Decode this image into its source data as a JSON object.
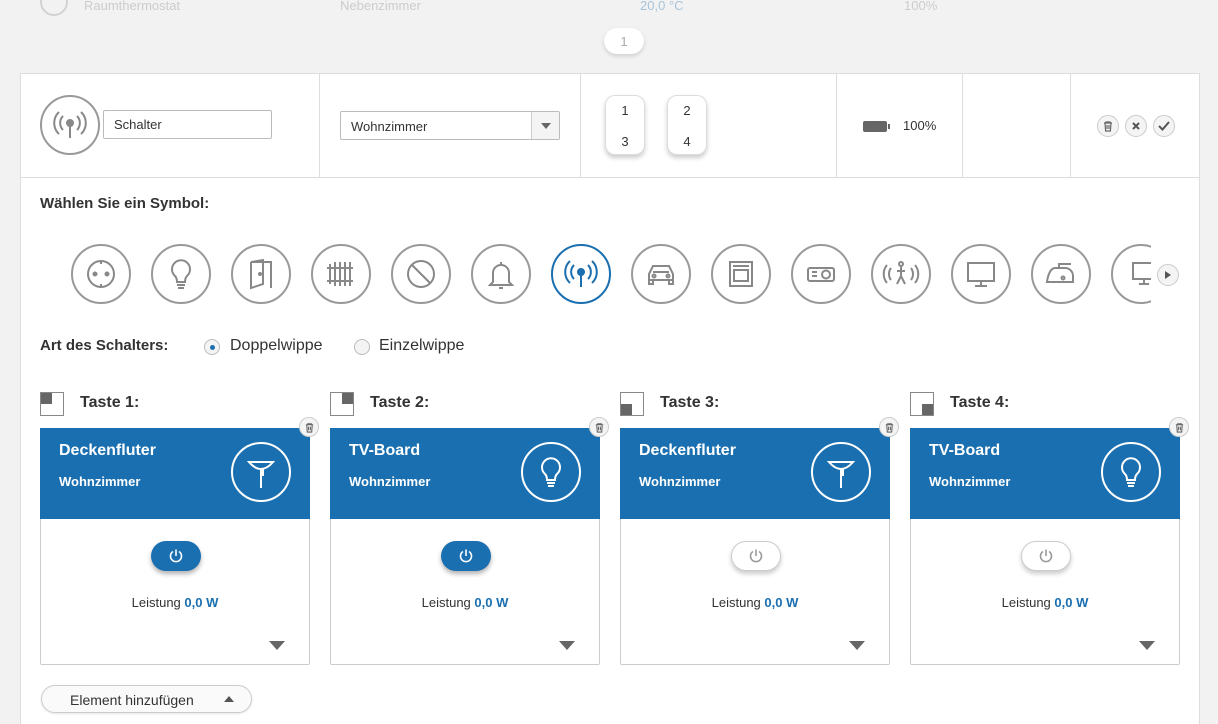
{
  "ghost": {
    "device": "Raumthermostat",
    "room": "Nebenzimmer",
    "temp": "20,0 °C",
    "battery": "100%",
    "page": "1"
  },
  "header": {
    "device_name": "Schalter",
    "room_selected": "Wohnzimmer",
    "keys": [
      "1",
      "3",
      "2",
      "4"
    ],
    "battery_text": "100%"
  },
  "symbols": {
    "title": "Wählen Sie ein Symbol:",
    "items": [
      "socket-icon",
      "bulb-icon",
      "door-icon",
      "radiator-icon",
      "blocked-icon",
      "bell-icon",
      "radio-signal-icon",
      "car-icon",
      "oven-icon",
      "projector-icon",
      "motion-icon",
      "monitor-icon",
      "iron-icon",
      "computer-icon"
    ],
    "selected": "radio-signal-icon"
  },
  "switch_type": {
    "label": "Art des Schalters:",
    "options": [
      "Doppelwippe",
      "Einzelwippe"
    ],
    "selected": "Doppelwippe"
  },
  "tasten": [
    {
      "title": "Taste 1:",
      "name": "Deckenfluter",
      "room": "Wohnzimmer",
      "icon": "floor-lamp-icon",
      "power": "on",
      "leistung_label": "Leistung",
      "leistung_value": "0,0 W"
    },
    {
      "title": "Taste 2:",
      "name": "TV-Board",
      "room": "Wohnzimmer",
      "icon": "bulb-icon",
      "power": "on",
      "leistung_label": "Leistung",
      "leistung_value": "0,0 W"
    },
    {
      "title": "Taste 3:",
      "name": "Deckenfluter",
      "room": "Wohnzimmer",
      "icon": "floor-lamp-icon",
      "power": "off",
      "leistung_label": "Leistung",
      "leistung_value": "0,0 W"
    },
    {
      "title": "Taste 4:",
      "name": "TV-Board",
      "room": "Wohnzimmer",
      "icon": "bulb-icon",
      "power": "off",
      "leistung_label": "Leistung",
      "leistung_value": "0,0 W"
    }
  ],
  "add_button": "Element hinzufügen",
  "colors": {
    "accent": "#1a6fb0"
  }
}
